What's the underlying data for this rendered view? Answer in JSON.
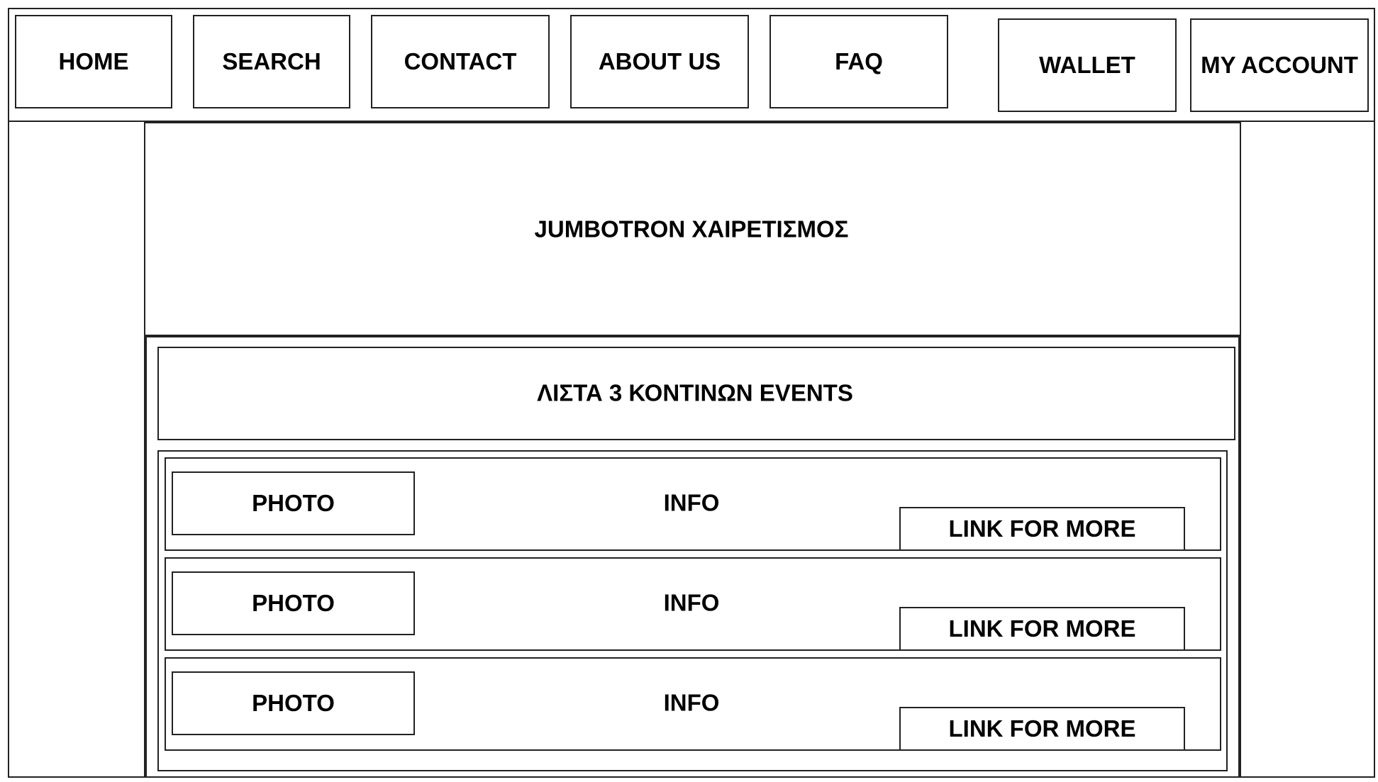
{
  "nav": {
    "items": [
      {
        "label": "HOME"
      },
      {
        "label": "SEARCH"
      },
      {
        "label": "CONTACT"
      },
      {
        "label": "ABOUT US"
      },
      {
        "label": "FAQ"
      }
    ],
    "right": [
      {
        "label": "WALLET"
      },
      {
        "label": "MY ACCOUNT"
      }
    ]
  },
  "jumbotron": {
    "text": "JUMBOTRON ΧΑΙΡΕΤΙΣΜΟΣ"
  },
  "events": {
    "header": "ΛΙΣΤΑ 3 ΚΟΝΤΙΝΩΝ EVENTS",
    "items": [
      {
        "photo": "PHOTO",
        "info": "INFO",
        "link": "LINK FOR MORE"
      },
      {
        "photo": "PHOTO",
        "info": "INFO",
        "link": "LINK FOR MORE"
      },
      {
        "photo": "PHOTO",
        "info": "INFO",
        "link": "LINK FOR MORE"
      }
    ]
  }
}
